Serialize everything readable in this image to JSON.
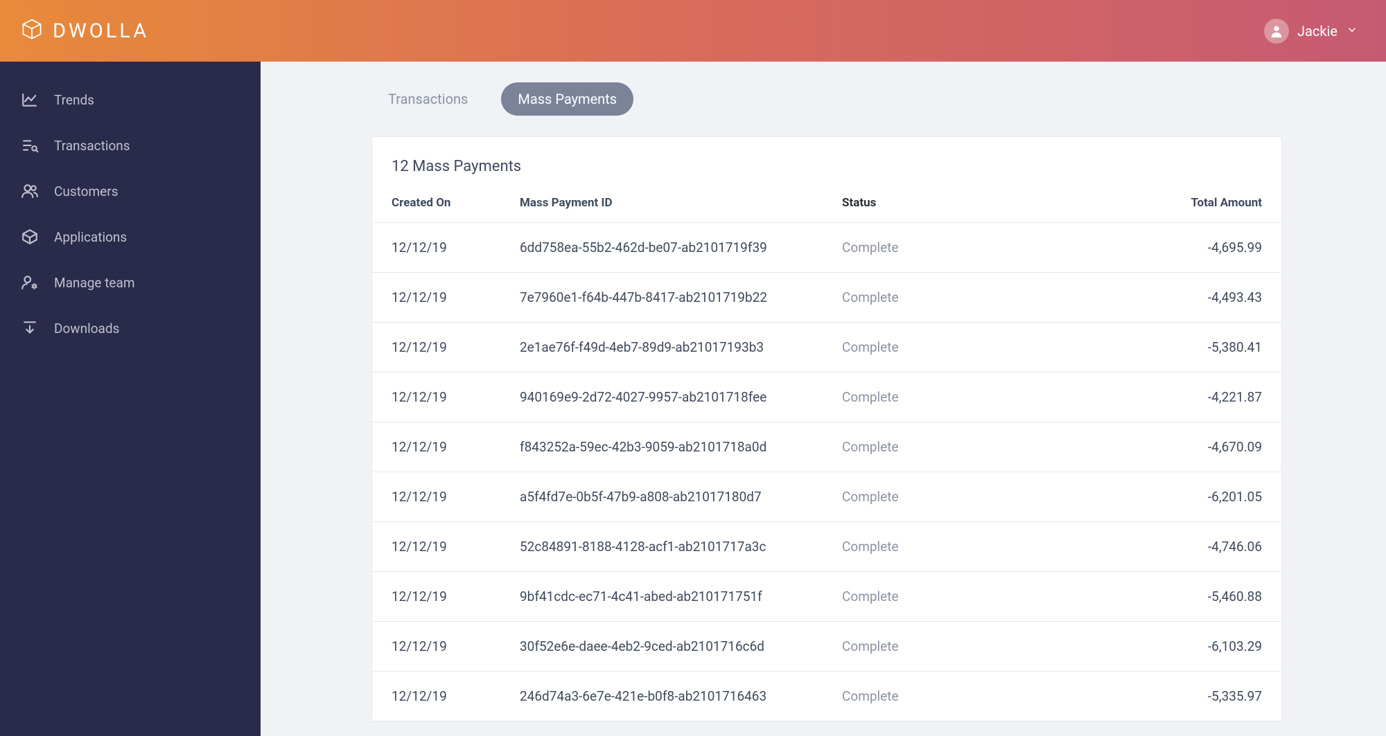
{
  "header": {
    "brand": "DWOLLA",
    "user_name": "Jackie"
  },
  "sidebar": {
    "items": [
      {
        "label": "Trends",
        "icon": "trends"
      },
      {
        "label": "Transactions",
        "icon": "transactions"
      },
      {
        "label": "Customers",
        "icon": "customers"
      },
      {
        "label": "Applications",
        "icon": "applications"
      },
      {
        "label": "Manage team",
        "icon": "manage-team"
      },
      {
        "label": "Downloads",
        "icon": "downloads"
      }
    ]
  },
  "tabs": {
    "items": [
      {
        "label": "Transactions",
        "active": false
      },
      {
        "label": "Mass Payments",
        "active": true
      }
    ]
  },
  "table": {
    "title": "12 Mass Payments",
    "columns": {
      "created_on": "Created On",
      "mass_payment_id": "Mass Payment ID",
      "status": "Status",
      "total_amount": "Total Amount"
    },
    "rows": [
      {
        "created_on": "12/12/19",
        "id": "6dd758ea-55b2-462d-be07-ab2101719f39",
        "status": "Complete",
        "amount": "-4,695.99"
      },
      {
        "created_on": "12/12/19",
        "id": "7e7960e1-f64b-447b-8417-ab2101719b22",
        "status": "Complete",
        "amount": "-4,493.43"
      },
      {
        "created_on": "12/12/19",
        "id": "2e1ae76f-f49d-4eb7-89d9-ab21017193b3",
        "status": "Complete",
        "amount": "-5,380.41"
      },
      {
        "created_on": "12/12/19",
        "id": "940169e9-2d72-4027-9957-ab2101718fee",
        "status": "Complete",
        "amount": "-4,221.87"
      },
      {
        "created_on": "12/12/19",
        "id": "f843252a-59ec-42b3-9059-ab2101718a0d",
        "status": "Complete",
        "amount": "-4,670.09"
      },
      {
        "created_on": "12/12/19",
        "id": "a5f4fd7e-0b5f-47b9-a808-ab21017180d7",
        "status": "Complete",
        "amount": "-6,201.05"
      },
      {
        "created_on": "12/12/19",
        "id": "52c84891-8188-4128-acf1-ab2101717a3c",
        "status": "Complete",
        "amount": "-4,746.06"
      },
      {
        "created_on": "12/12/19",
        "id": "9bf41cdc-ec71-4c41-abed-ab210171751f",
        "status": "Complete",
        "amount": "-5,460.88"
      },
      {
        "created_on": "12/12/19",
        "id": "30f52e6e-daee-4eb2-9ced-ab2101716c6d",
        "status": "Complete",
        "amount": "-6,103.29"
      },
      {
        "created_on": "12/12/19",
        "id": "246d74a3-6e7e-421e-b0f8-ab2101716463",
        "status": "Complete",
        "amount": "-5,335.97"
      }
    ]
  }
}
